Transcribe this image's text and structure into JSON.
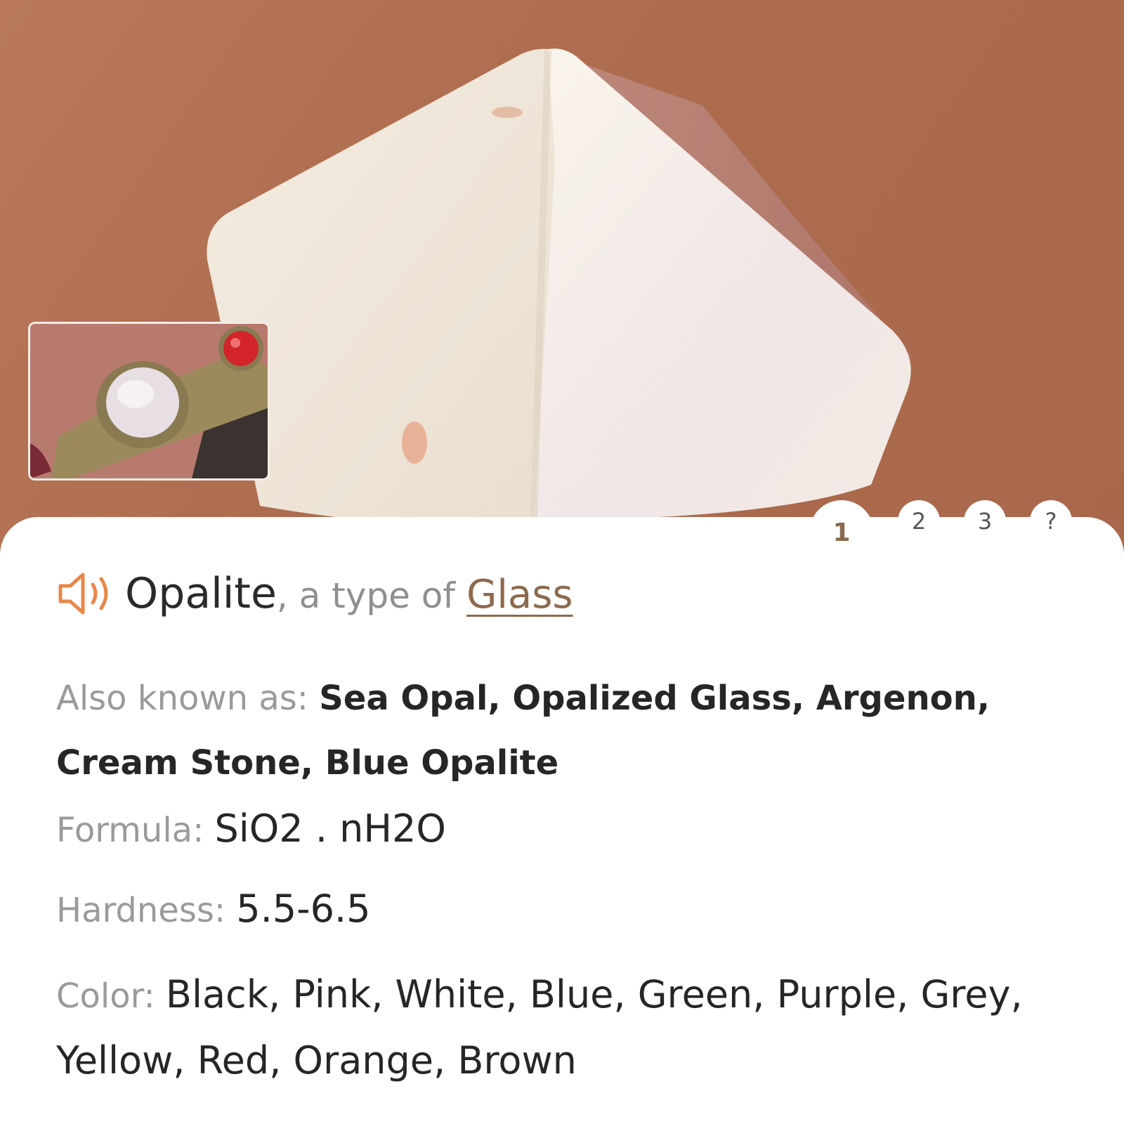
{
  "image": {
    "main_photo": "opalite-pyramid-photo",
    "thumbnail": "opalite-ring-photo"
  },
  "tabs": [
    {
      "label": "1",
      "active": true
    },
    {
      "label": "2",
      "active": false
    },
    {
      "label": "3",
      "active": false
    },
    {
      "label": "?",
      "active": false
    }
  ],
  "header": {
    "speaker_icon": "speaker-icon",
    "name": "Opalite",
    "type_prefix": ", a type of",
    "type_link": "Glass"
  },
  "details": {
    "aka_label": "Also known as:",
    "aka_value": "Sea Opal, Opalized Glass, Argenon, Cream Stone, Blue Opalite",
    "formula_label": "Formula:",
    "formula_value": "SiO2 . nH2O",
    "hardness_label": "Hardness:",
    "hardness_value": "5.5-6.5",
    "color_label": "Color:",
    "color_value": "Black, Pink, White, Blue, Green, Purple, Grey, Yellow, Red, Orange, Brown"
  },
  "colors": {
    "accent": "#e8874a",
    "link": "#8c6a4e"
  }
}
